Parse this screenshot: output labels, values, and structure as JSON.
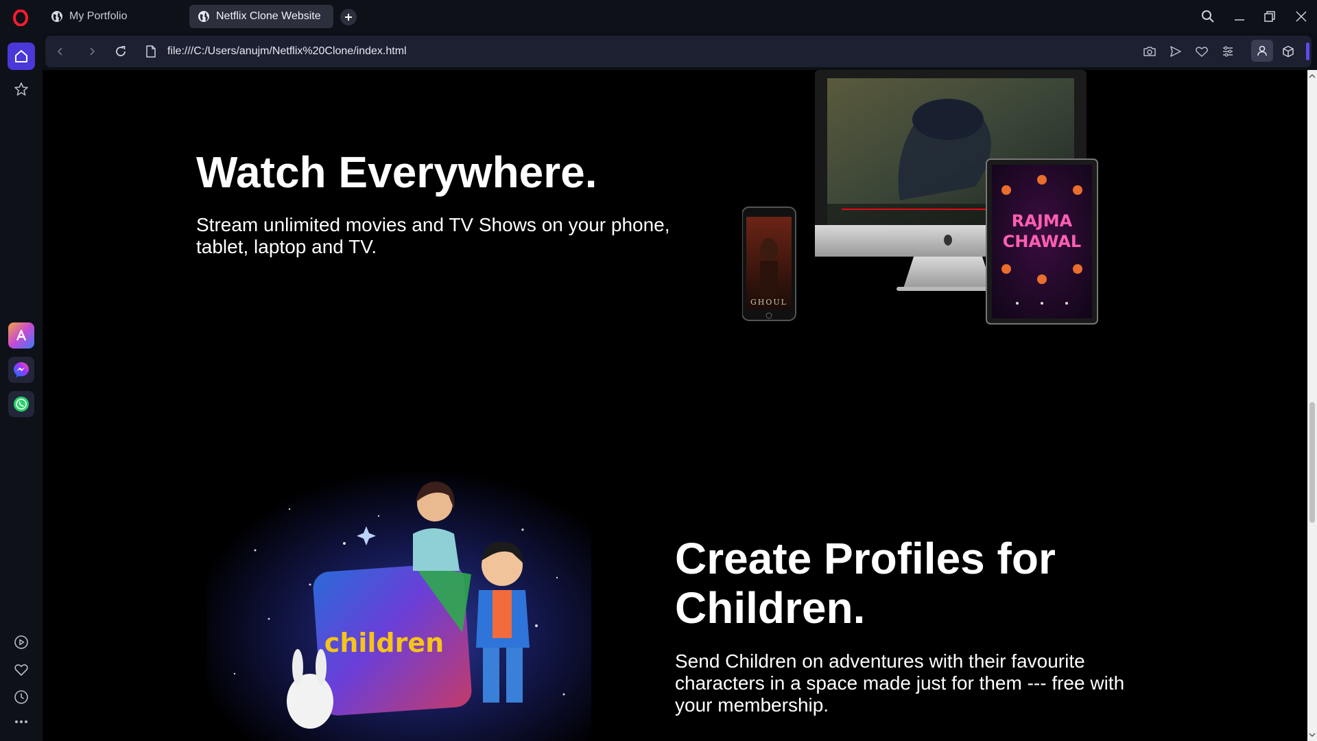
{
  "browser": {
    "tabs": [
      {
        "label": "My Portfolio",
        "active": false
      },
      {
        "label": "Netflix Clone Website",
        "active": true
      }
    ],
    "url": "file:///C:/Users/anujm/Netflix%20Clone/index.html",
    "accent_color": "#4a38d8"
  },
  "sidebar": {
    "items": [
      {
        "name": "home",
        "icon": "home-icon"
      },
      {
        "name": "bookmarks",
        "icon": "star-icon"
      },
      {
        "name": "aria",
        "icon": "aria-icon"
      },
      {
        "name": "messenger",
        "icon": "messenger-icon"
      },
      {
        "name": "whatsapp",
        "icon": "whatsapp-icon"
      },
      {
        "name": "player",
        "icon": "play-circle-icon"
      },
      {
        "name": "favorites",
        "icon": "heart-icon"
      },
      {
        "name": "history",
        "icon": "clock-icon"
      },
      {
        "name": "more",
        "icon": "more-icon"
      }
    ]
  },
  "page": {
    "watch": {
      "title": "Watch Everywhere.",
      "text": "Stream unlimited movies and TV Shows on your phone, tablet, laptop and TV."
    },
    "devices": {
      "phone_title": "GHOUL",
      "tablet_title": "RAJMA CHAWAL"
    },
    "kids": {
      "title": "Create Profiles for Children.",
      "text": "Send Children on adventures with their favourite characters in a space made just for them --- free with your membership.",
      "badge": "children"
    }
  }
}
